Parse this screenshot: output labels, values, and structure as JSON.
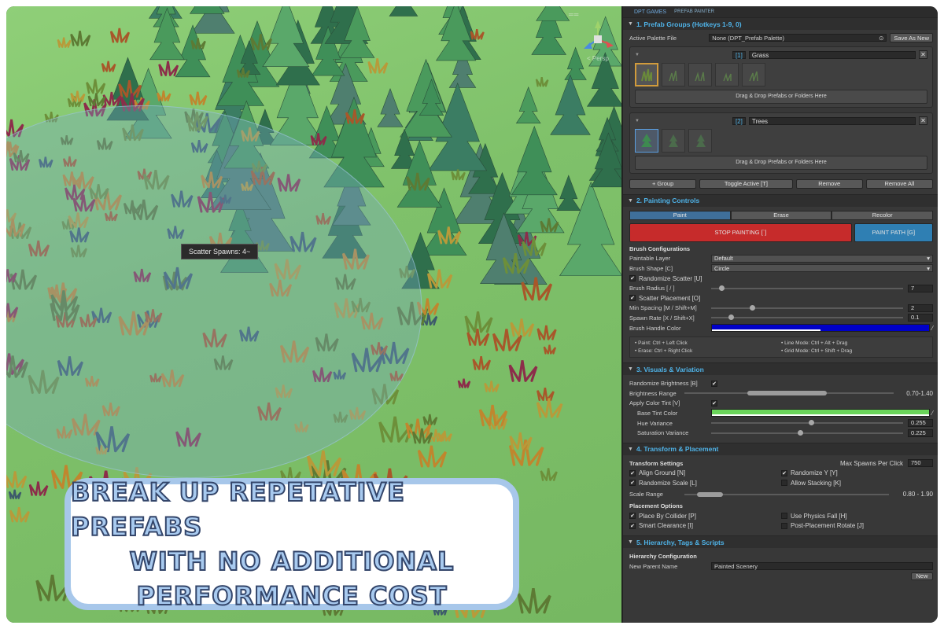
{
  "scene": {
    "tooltip": "Scatter Spawns: 4~",
    "gizmo_label": "< Persp",
    "gizmo_lines": "══",
    "promo_lines": [
      "BREAK UP REPETATIVE PREFABS",
      "WITH NO ADDITIONAL",
      "PERFORMANCE COST"
    ]
  },
  "inspector": {
    "header_left": "DPT GAMES",
    "header_right": "PREFAB PAINTER",
    "prefab_groups": {
      "title": "1. Prefab Groups (Hotkeys 1-9, 0)",
      "palette_label": "Active Palette File",
      "palette_value": "None (DPT_Prefab Palette)",
      "save_as_new": "Save As New",
      "groups": [
        {
          "index": "[1]",
          "name": "Grass",
          "drop_label": "Drag & Drop Prefabs or Folders Here"
        },
        {
          "index": "[2]",
          "name": "Trees",
          "drop_label": "Drag & Drop Prefabs or Folders Here"
        }
      ],
      "buttons": {
        "add_group": "+ Group",
        "toggle_active": "Toggle Active [T]",
        "remove": "Remove",
        "remove_all": "Remove All"
      }
    },
    "painting_controls": {
      "title": "2. Painting Controls",
      "tabs": [
        "Paint",
        "Erase",
        "Recolor"
      ],
      "active_tab": "Paint",
      "stop_painting": "STOP PAINTING [`]",
      "paint_path": "PAINT PATH [G]",
      "brush_config_title": "Brush Configurations",
      "paintable_layer_label": "Paintable Layer",
      "paintable_layer_value": "Default",
      "brush_shape_label": "Brush Shape [C]",
      "brush_shape_value": "Circle",
      "randomize_scatter_label": "Randomize Scatter [U]",
      "brush_radius_label": "Brush Radius [ / ]",
      "brush_radius_value": "7",
      "scatter_placement_label": "Scatter Placement [O]",
      "min_spacing_label": "Min Spacing [M / Shift+M]",
      "min_spacing_value": "2",
      "spawn_rate_label": "Spawn Rate [X / Shift+X]",
      "spawn_rate_value": "0.1",
      "brush_handle_color_label": "Brush Handle Color",
      "hints": [
        "• Paint: Ctrl + Left Click",
        "• Line Mode: Ctrl + Alt + Drag",
        "• Erase: Ctrl + Right Click",
        "• Grid Mode: Ctrl + Shift + Drag"
      ]
    },
    "visuals": {
      "title": "3. Visuals & Variation",
      "randomize_brightness_label": "Randomize Brightness [B]",
      "brightness_range_label": "Brightness Range",
      "brightness_range_value": "0.70-1.40",
      "apply_color_tint_label": "Apply Color Tint [V]",
      "base_tint_color_label": "Base Tint Color",
      "hue_variance_label": "Hue Variance",
      "hue_variance_value": "0.255",
      "saturation_variance_label": "Saturation Variance",
      "saturation_variance_value": "0.225"
    },
    "transform": {
      "title": "4. Transform & Placement",
      "transform_settings_title": "Transform Settings",
      "max_spawns_label": "Max Spawns Per Click",
      "max_spawns_value": "750",
      "align_ground_label": "Align Ground [N]",
      "randomize_y_label": "Randomize Y [Y]",
      "randomize_scale_label": "Randomize Scale [L]",
      "allow_stacking_label": "Allow Stacking [K]",
      "scale_range_label": "Scale Range",
      "scale_range_value": "0.80 - 1.90",
      "placement_options_title": "Placement Options",
      "place_by_collider_label": "Place By Collider [P]",
      "use_physics_fall_label": "Use Physics Fall [H]",
      "smart_clearance_label": "Smart Clearance [I]",
      "post_placement_rotate_label": "Post-Placement Rotate [J]"
    },
    "hierarchy": {
      "title": "5. Hierarchy, Tags & Scripts",
      "config_title": "Hierarchy Configuration",
      "new_parent_label": "New Parent Name",
      "new_parent_value": "Painted Scenery",
      "new_button": "New"
    }
  },
  "colors": {
    "accent_blue": "#4fb3e8",
    "stop_red": "#c62b2b",
    "path_blue": "#2f7fb3",
    "handle_color": "#0000c8",
    "tint_color": "#6ad45a",
    "active_tab": "#3f6f9a"
  }
}
